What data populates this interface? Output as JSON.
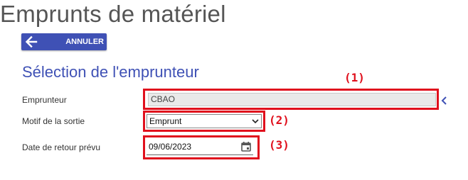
{
  "page": {
    "title": "Emprunts de matériel"
  },
  "toolbar": {
    "cancel_label": "ANNULER"
  },
  "section": {
    "title": "Sélection de l'emprunteur"
  },
  "form": {
    "borrower": {
      "label": "Emprunteur",
      "value": "CBAO"
    },
    "reason": {
      "label": "Motif de la sortie",
      "value": "Emprunt"
    },
    "return_date": {
      "label": "Date de retour prévu",
      "value": "09/06/2023"
    }
  },
  "annotations": {
    "one": "(1)",
    "two": "(2)",
    "three": "(3)"
  },
  "colors": {
    "accent": "#3f51b5",
    "annotation": "#e0101d",
    "readonly_bg": "#e9e9e9"
  },
  "icons": {
    "back": "arrow-left-icon",
    "expand": "chevron-left-icon",
    "dropdown": "chevron-down-icon",
    "calendar": "calendar-icon"
  }
}
